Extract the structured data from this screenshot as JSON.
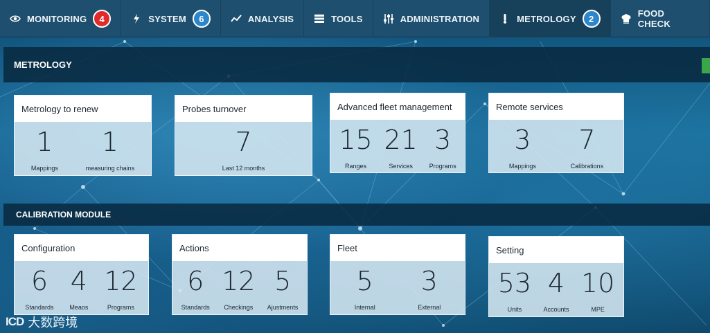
{
  "nav": {
    "items": [
      {
        "label": "MONITORING",
        "icon": "eye-icon",
        "badge": "4",
        "badge_color": "#e12a2a"
      },
      {
        "label": "SYSTEM",
        "icon": "bolt-icon",
        "badge": "6",
        "badge_color": "#2d86c9"
      },
      {
        "label": "ANALYSIS",
        "icon": "trend-icon"
      },
      {
        "label": "TOOLS",
        "icon": "server-icon"
      },
      {
        "label": "ADMINISTRATION",
        "icon": "sliders-icon"
      },
      {
        "label": "METROLOGY",
        "icon": "thermometer-icon",
        "badge": "2",
        "badge_color": "#2d86c9"
      },
      {
        "label": "FOOD CHECK",
        "icon": "chef-hat-icon"
      }
    ]
  },
  "sections": {
    "metrology": "METROLOGY",
    "calibration": "CALIBRATION MODULE"
  },
  "metrology_cards": [
    {
      "title": "Metrology to renew",
      "metrics": [
        {
          "value": "1",
          "label": "Mappings"
        },
        {
          "value": "1",
          "label": "measuring chains"
        }
      ]
    },
    {
      "title": "Probes turnover",
      "metrics": [
        {
          "value": "7",
          "label": "Last 12 months"
        }
      ]
    },
    {
      "title": "Advanced fleet management",
      "metrics": [
        {
          "value": "15",
          "label": "Ranges"
        },
        {
          "value": "21",
          "label": "Services"
        },
        {
          "value": "3",
          "label": "Programs"
        }
      ]
    },
    {
      "title": "Remote services",
      "metrics": [
        {
          "value": "3",
          "label": "Mappings"
        },
        {
          "value": "7",
          "label": "Calibrations"
        }
      ]
    }
  ],
  "calibration_cards": [
    {
      "title": "Configuration",
      "metrics": [
        {
          "value": "6",
          "label": "Standards"
        },
        {
          "value": "4",
          "label": "Meaos"
        },
        {
          "value": "12",
          "label": "Programs"
        }
      ]
    },
    {
      "title": "Actions",
      "metrics": [
        {
          "value": "6",
          "label": "Standards"
        },
        {
          "value": "12",
          "label": "Checkings"
        },
        {
          "value": "5",
          "label": "Ajustments"
        }
      ]
    },
    {
      "title": "Fleet",
      "metrics": [
        {
          "value": "5",
          "label": "Internal"
        },
        {
          "value": "3",
          "label": "External"
        }
      ]
    },
    {
      "title": "Setting",
      "metrics": [
        {
          "value": "53",
          "label": "Units"
        },
        {
          "value": "4",
          "label": "Accounts"
        },
        {
          "value": "10",
          "label": "MPE"
        }
      ]
    }
  ],
  "watermark": {
    "logo": "ICD",
    "text": "大数跨境"
  }
}
